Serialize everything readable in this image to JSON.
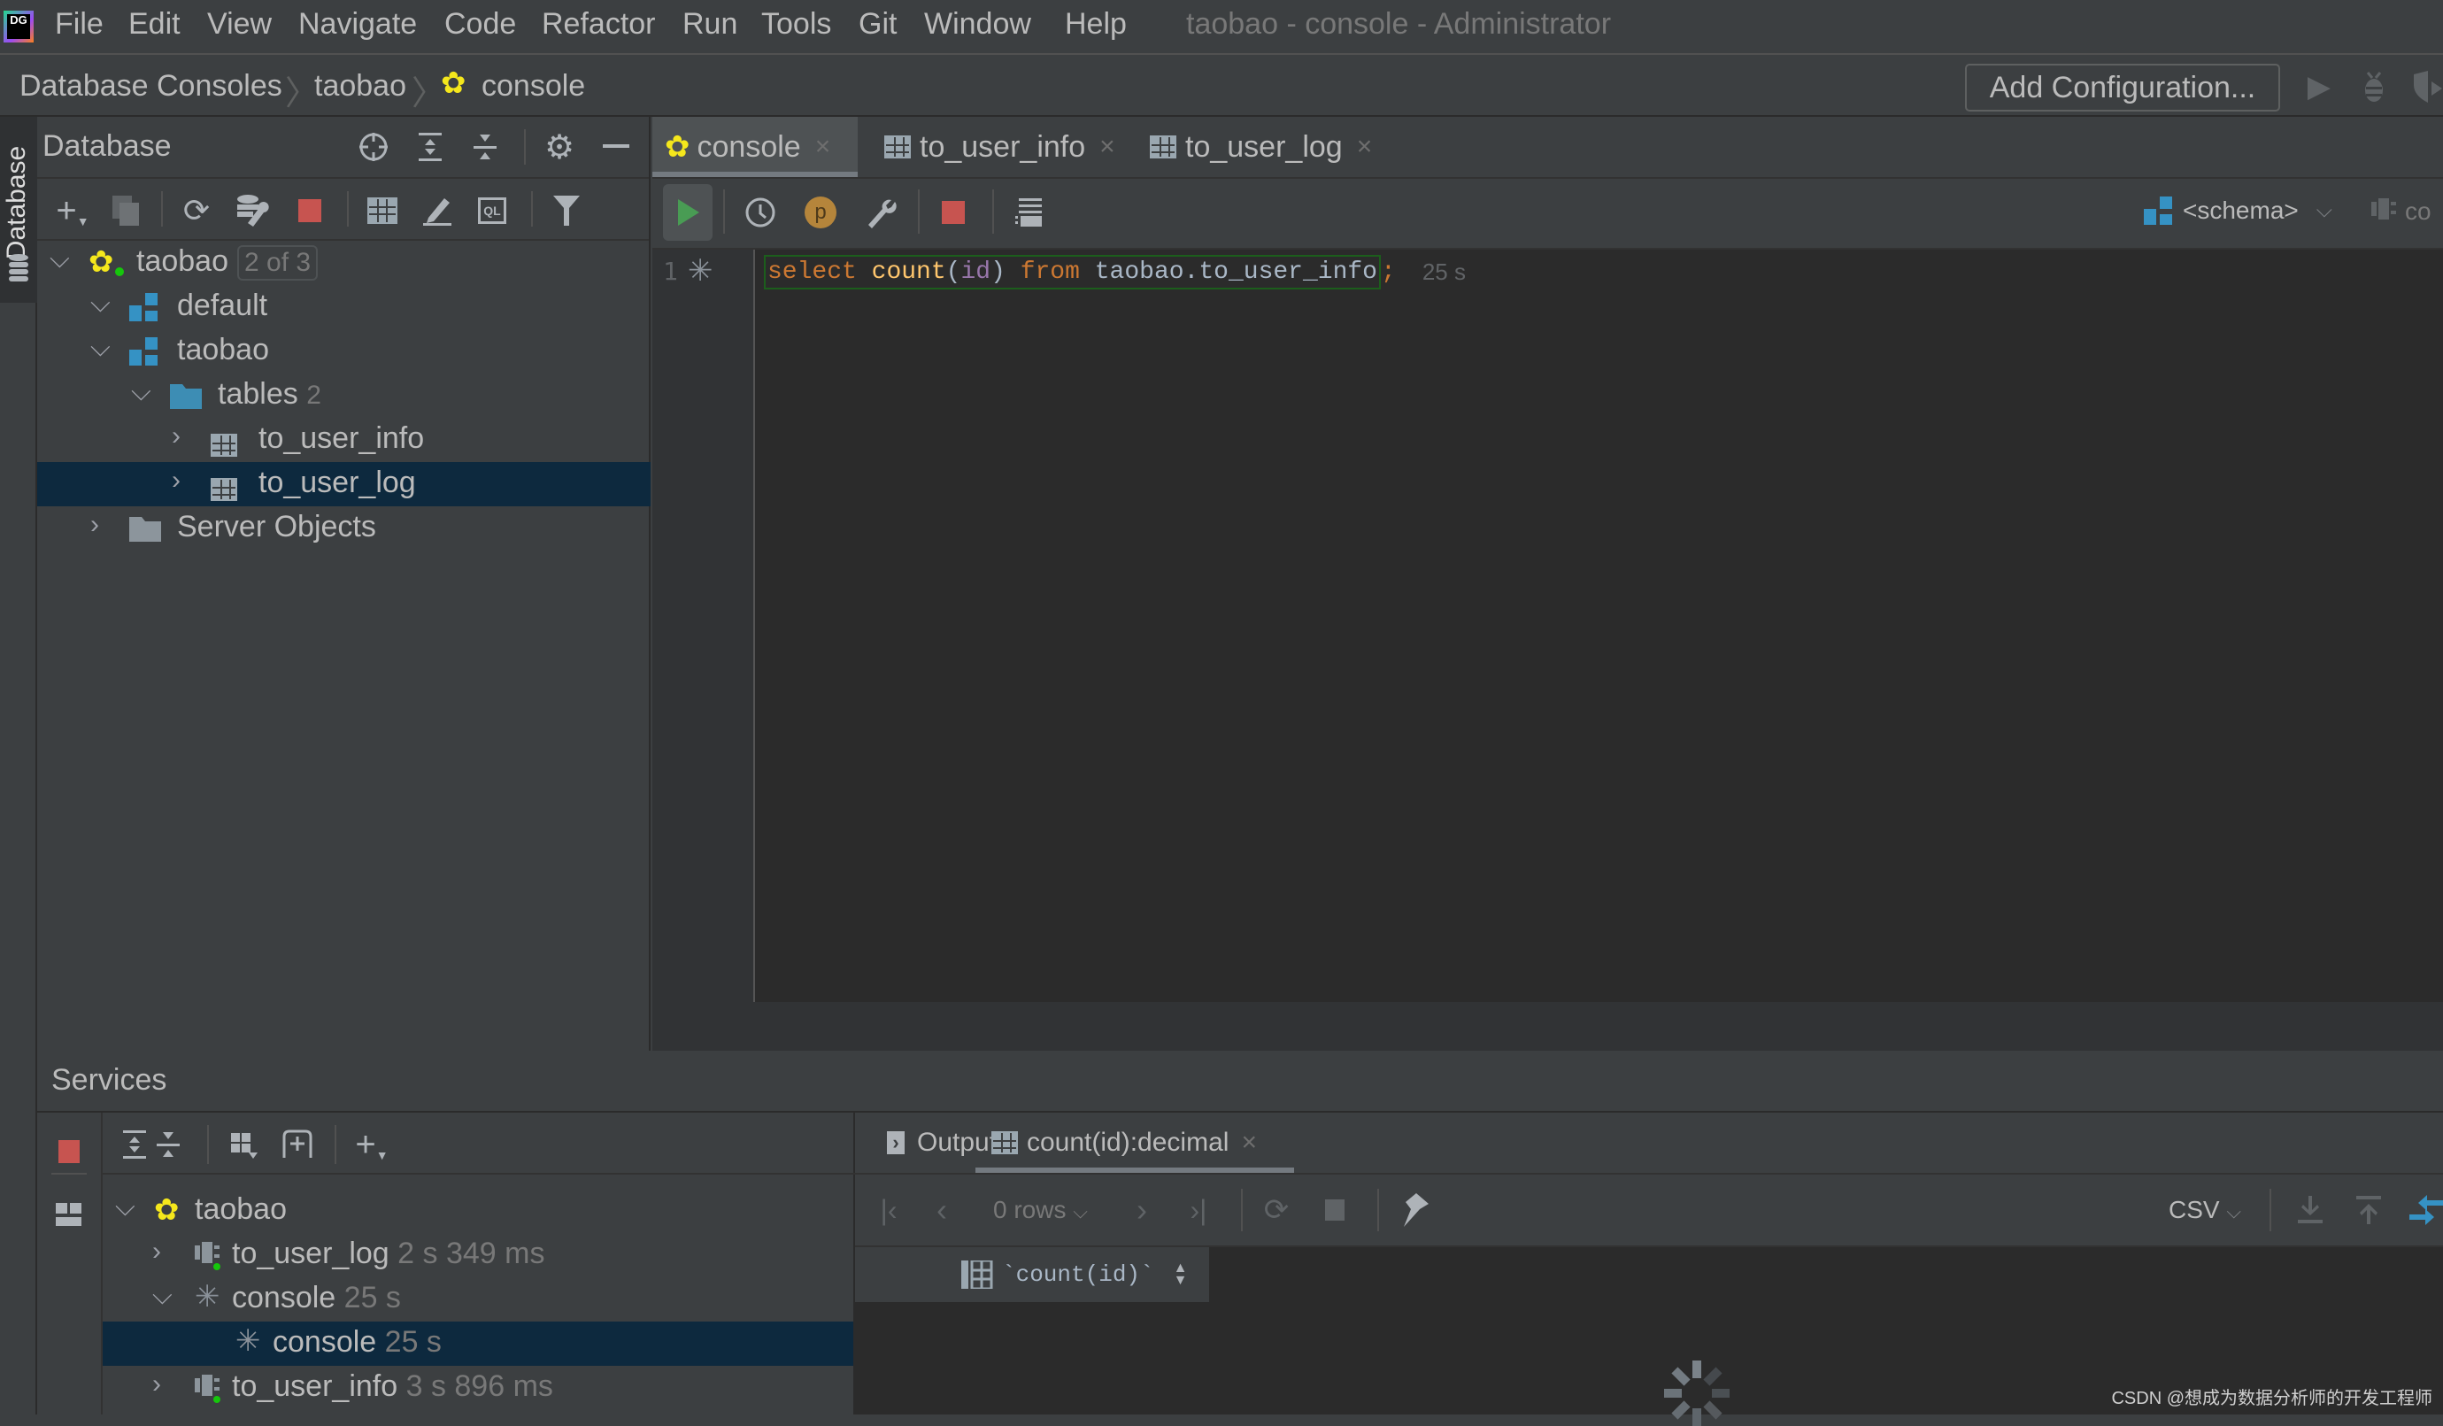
{
  "app": {
    "logo_text": "DG",
    "window_title": "taobao - console - Administrator",
    "menu": [
      "File",
      "Edit",
      "View",
      "Navigate",
      "Code",
      "Refactor",
      "Run",
      "Tools",
      "Git",
      "Window",
      "Help"
    ]
  },
  "breadcrumb": {
    "items": [
      "Database Consoles",
      "taobao",
      "console"
    ],
    "add_configuration": "Add Configuration..."
  },
  "left_stripe": {
    "database_label": "Database"
  },
  "database_panel": {
    "title": "Database",
    "tree": [
      {
        "label": "taobao",
        "badge": "2 of 3",
        "level": 0,
        "expanded": true,
        "icon": "datasource-icon"
      },
      {
        "label": "default",
        "level": 1,
        "expanded": true,
        "icon": "schema-icon"
      },
      {
        "label": "taobao",
        "level": 1,
        "expanded": true,
        "icon": "schema-icon"
      },
      {
        "label": "tables",
        "count": "2",
        "level": 2,
        "expanded": true,
        "icon": "folder-icon"
      },
      {
        "label": "to_user_info",
        "level": 3,
        "expanded": false,
        "icon": "table-icon"
      },
      {
        "label": "to_user_log",
        "level": 3,
        "expanded": false,
        "icon": "table-icon",
        "selected": true
      },
      {
        "label": "Server Objects",
        "level": 1,
        "expanded": false,
        "icon": "folder-icon"
      }
    ]
  },
  "editor": {
    "tabs": [
      {
        "label": "console",
        "active": true
      },
      {
        "label": "to_user_info",
        "active": false
      },
      {
        "label": "to_user_log",
        "active": false
      }
    ],
    "schema_selector": "<schema>",
    "session_label": "co",
    "line_number": "1",
    "code": {
      "kw_select": "select",
      "fn_count": "count",
      "paren_open": "(",
      "arg_id": "id",
      "paren_close": ")",
      "kw_from": "from",
      "target": "taobao.to_user_info",
      "semicolon": ";"
    },
    "exec_time": "25 s"
  },
  "services": {
    "title": "Services",
    "tree": [
      {
        "label": "taobao",
        "time": "",
        "level": 0,
        "expanded": true
      },
      {
        "label": "to_user_log",
        "time": "2 s 349 ms",
        "level": 1,
        "expanded": false
      },
      {
        "label": "console",
        "time": "25 s",
        "level": 1,
        "expanded": true
      },
      {
        "label": "console",
        "time": "25 s",
        "level": 2,
        "selected": true
      },
      {
        "label": "to_user_info",
        "time": "3 s 896 ms",
        "level": 1,
        "expanded": false
      }
    ]
  },
  "result": {
    "tabs": [
      {
        "label": "Output",
        "active": false
      },
      {
        "label": "count(id):decimal",
        "active": true
      }
    ],
    "rows_label": "0 rows",
    "export_format": "CSV",
    "column_header": "`count(id)`"
  },
  "watermark": "CSDN @想成为数据分析师的开发工程师",
  "colors": {
    "background": "#3c3f41",
    "editor_bg": "#2b2b2b",
    "selection": "#0d293e",
    "keyword": "#cc7832",
    "function": "#ffc66d",
    "identifier": "#9876aa",
    "run_green": "#499c54",
    "stop_red": "#c75450",
    "schema_blue": "#3592c4"
  }
}
